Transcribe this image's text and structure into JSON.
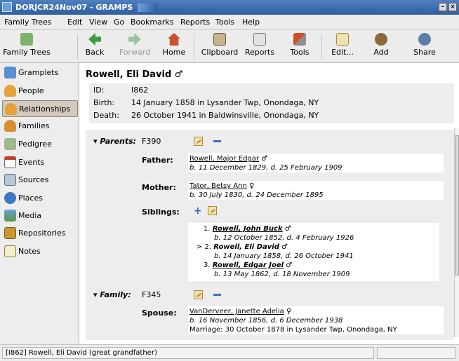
{
  "window": {
    "title": "DORJCR24Nov07 - GRAMPS",
    "min_label": "–",
    "close_label": "×"
  },
  "menubar": [
    "Family Trees",
    "Edit",
    "View",
    "Go",
    "Bookmarks",
    "Reports",
    "Tools",
    "Help"
  ],
  "toolbar": {
    "family_trees": "Family Trees",
    "back": "Back",
    "forward": "Forward",
    "home": "Home",
    "clipboard": "Clipboard",
    "reports": "Reports",
    "tools": "Tools",
    "edit": "Edit...",
    "add": "Add",
    "share": "Share"
  },
  "sidebar": {
    "items": [
      {
        "label": "Gramplets",
        "icon": "gramplets-icon"
      },
      {
        "label": "People",
        "icon": "person-icon"
      },
      {
        "label": "Relationships",
        "icon": "relationships-icon"
      },
      {
        "label": "Families",
        "icon": "families-icon"
      },
      {
        "label": "Pedigree",
        "icon": "pedigree-icon"
      },
      {
        "label": "Events",
        "icon": "calendar-icon"
      },
      {
        "label": "Sources",
        "icon": "sources-icon"
      },
      {
        "label": "Places",
        "icon": "globe-icon"
      },
      {
        "label": "Media",
        "icon": "media-icon"
      },
      {
        "label": "Repositories",
        "icon": "repository-icon"
      },
      {
        "label": "Notes",
        "icon": "note-icon"
      }
    ],
    "active": "Relationships"
  },
  "person": {
    "name": "Rowell, Eli David ♂",
    "id_label": "ID:",
    "id": "I862",
    "birth_label": "Birth:",
    "birth": "14 January 1858 in Lysander Twp, Onondaga, NY",
    "death_label": "Death:",
    "death": "26 October 1941 in Baldwinsville, Onondaga, NY"
  },
  "parents": {
    "label": "▾ Parents:",
    "family_id": "F390",
    "father_label": "Father:",
    "father_name": "Rowell, Major Edgar",
    "father_sex": "♂",
    "father_dates": "b. 11 December 1829, d. 25 February 1909",
    "mother_label": "Mother:",
    "mother_name": "Tator, Betsy Ann",
    "mother_sex": "♀",
    "mother_dates": "b. 30 July 1830, d. 24 December 1895",
    "siblings_label": "Siblings:",
    "siblings": [
      {
        "marker": "1.",
        "name": "Rowell, John Buck",
        "sex": "♂",
        "dates": "b. 12 October 1852, d. 4 February 1926"
      },
      {
        "marker": "> 2.",
        "name": "Rowell, Eli David",
        "sex": "♂",
        "dates": "b. 14 January 1858, d. 26 October 1941"
      },
      {
        "marker": "3.",
        "name": "Rowell, Edgar Joel",
        "sex": "♂",
        "dates": "b. 13 May 1862, d. 18 November 1909"
      }
    ]
  },
  "family": {
    "label": "▾ Family:",
    "family_id": "F345",
    "spouse_label": "Spouse:",
    "spouse_name": "VanDerveer, Janette Adelia",
    "spouse_sex": "♀",
    "spouse_dates": "b. 16 November 1856, d. 6 December 1938",
    "marriage": "Marriage: 30 October 1878 in Lysander Twp, Onondaga, NY"
  },
  "statusbar": {
    "text": "[I862] Rowell, Eli David (great grandfather)"
  }
}
